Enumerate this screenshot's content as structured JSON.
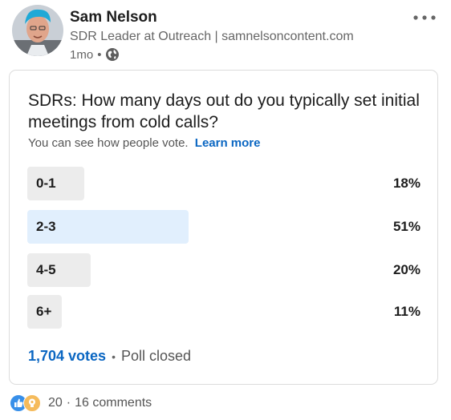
{
  "post": {
    "author_name": "Sam Nelson",
    "author_headline": "SDR Leader at Outreach | samnelsoncontent.com",
    "timestamp": "1mo",
    "meta_separator": "•",
    "visibility_icon": "globe-icon",
    "more_icon": "ellipsis-icon"
  },
  "poll": {
    "question": "SDRs: How many days out do you typically set initial meetings from cold calls?",
    "note": "You can see how people vote.",
    "learn_more": "Learn more",
    "options": [
      {
        "label": "0-1",
        "percent_label": "18%",
        "percent": 18,
        "is_top": false
      },
      {
        "label": "2-3",
        "percent_label": "51%",
        "percent": 51,
        "is_top": true
      },
      {
        "label": "4-5",
        "percent_label": "20%",
        "percent": 20,
        "is_top": false
      },
      {
        "label": "6+",
        "percent_label": "11%",
        "percent": 11,
        "is_top": false
      }
    ],
    "votes": "1,704 votes",
    "separator": "•",
    "status": "Poll closed"
  },
  "social": {
    "reaction_icons": [
      "like-icon",
      "insightful-icon"
    ],
    "reaction_count": "20",
    "separator": "·",
    "comments": "16 comments"
  },
  "colors": {
    "link_blue": "#0a66c2",
    "top_option_bar": "#e1effd",
    "option_bar": "#ececec",
    "like_blue": "#378fe9",
    "insightful_yellow": "#f5bb5c"
  }
}
